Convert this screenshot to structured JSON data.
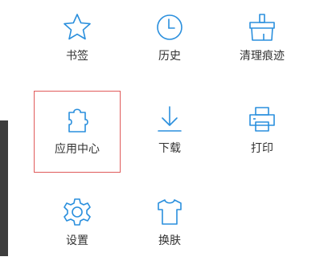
{
  "menu": {
    "accent_color": "#2a8fdd",
    "selected_border_color": "#e05a5a",
    "selected_item": "apps",
    "items": [
      {
        "id": "bookmarks",
        "label": "书签",
        "icon": "star-icon"
      },
      {
        "id": "history",
        "label": "历史",
        "icon": "clock-icon"
      },
      {
        "id": "clear",
        "label": "清理痕迹",
        "icon": "broom-icon"
      },
      {
        "id": "apps",
        "label": "应用中心",
        "icon": "puzzle-icon"
      },
      {
        "id": "download",
        "label": "下载",
        "icon": "download-icon"
      },
      {
        "id": "print",
        "label": "打印",
        "icon": "printer-icon"
      },
      {
        "id": "settings",
        "label": "设置",
        "icon": "gear-icon"
      },
      {
        "id": "skin",
        "label": "换肤",
        "icon": "tshirt-icon"
      }
    ]
  }
}
